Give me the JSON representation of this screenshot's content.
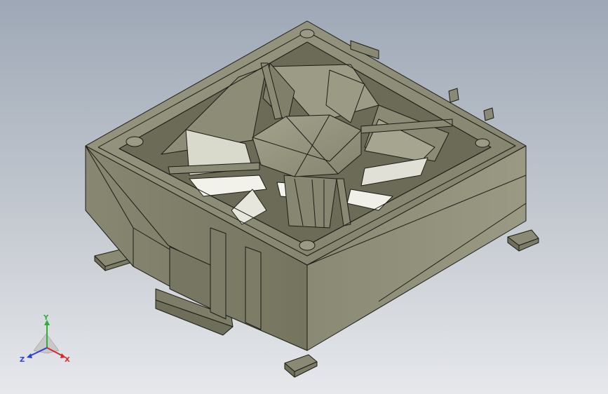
{
  "triad": {
    "x_label": "X",
    "y_label": "Y",
    "z_label": "Z",
    "x_color": "#d42a2a",
    "y_color": "#2fae3a",
    "z_color": "#2a3fd4"
  },
  "model": {
    "body_color": "#8e8e78",
    "edge_color": "#1c1c16",
    "highlight_color": "#e8e8de"
  }
}
